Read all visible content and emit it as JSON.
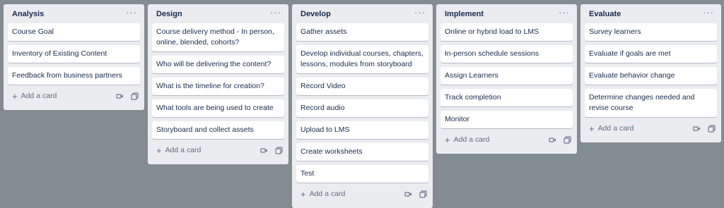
{
  "lists": [
    {
      "title": "Analysis",
      "menu": "···",
      "cards": [
        "Course Goal",
        "Inventory of Existing Content",
        "Feedback from business partners"
      ],
      "add_label": "Add a card"
    },
    {
      "title": "Design",
      "menu": "···",
      "cards": [
        "Course delivery method - In person, online, blended, cohorts?",
        "Who will be delivering the content?",
        "What is the timeline for creation?",
        "What tools are being used to create",
        "Storyboard and collect assets"
      ],
      "add_label": "Add a card"
    },
    {
      "title": "Develop",
      "menu": "···",
      "cards": [
        "Gather assets",
        "Develop individual courses, chapters, lessons, modules from storyboard",
        "Record Video",
        "Record audio",
        "Upload to LMS",
        "Create worksheets",
        "Test"
      ],
      "add_label": "Add a card"
    },
    {
      "title": "Implement",
      "menu": "···",
      "cards": [
        "Online or hybrid load to LMS",
        "In-person schedule sessions",
        "Assign Learners",
        "Track completion",
        "Monitor"
      ],
      "add_label": "Add a card"
    },
    {
      "title": "Evaluate",
      "menu": "···",
      "cards": [
        "Survey learners",
        "Evaluate if goals are met",
        "Evaluate behavior change",
        "Determine changes needed and revise course"
      ],
      "add_label": "Add a card"
    }
  ],
  "icons": {
    "add": "plus-icon",
    "template": "card-template-icon",
    "copy": "copy-icon"
  },
  "colors": {
    "board_background": "#838c91",
    "list_background": "#ebecf0",
    "card_text": "#172b4d",
    "muted_text": "#5e6c84"
  }
}
